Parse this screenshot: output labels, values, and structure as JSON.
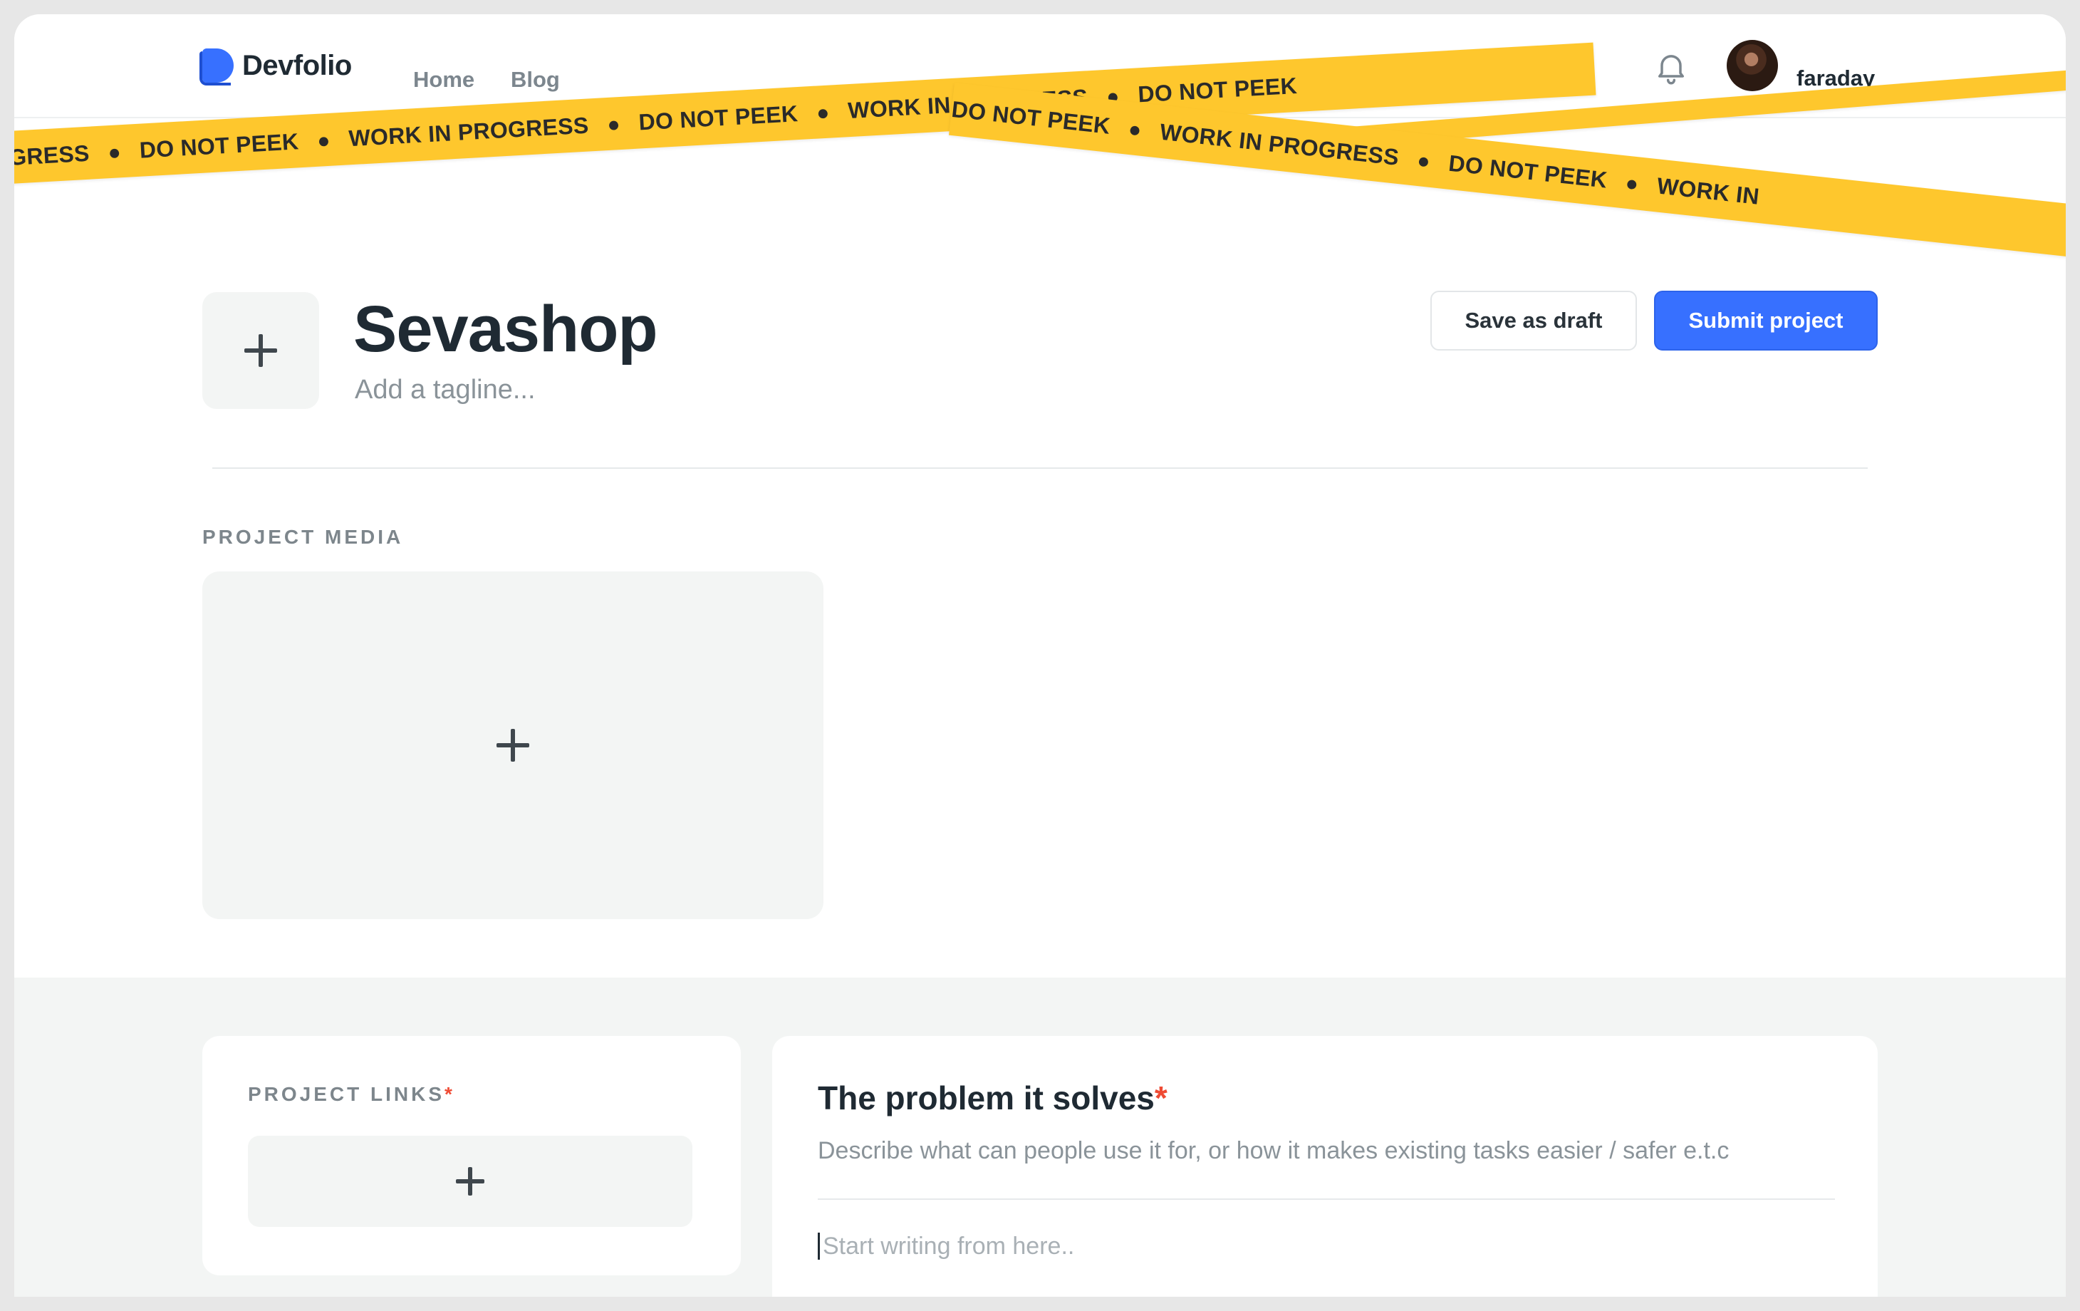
{
  "nav": {
    "logo_text": "Devfolio",
    "links": [
      "Home",
      "Blog"
    ],
    "user": {
      "name": "faraday"
    }
  },
  "tape": {
    "phrases": [
      "PROGRESS",
      "DO NOT PEEK",
      "WORK IN PROGRESS",
      "DO NOT PEEK",
      "WORK IN PROGRESS",
      "DO NOT PEEK",
      "WORK IN PROGRESS",
      "DO NOT PEEK",
      "WORK IN"
    ],
    "color": "#fec72d"
  },
  "project": {
    "title": "Sevashop",
    "tagline_placeholder": "Add a tagline..."
  },
  "actions": {
    "save_draft": "Save as draft",
    "submit": "Submit project"
  },
  "media": {
    "label": "PROJECT MEDIA"
  },
  "links_card": {
    "label": "PROJECT LINKS",
    "required_mark": "*"
  },
  "problem_card": {
    "title": "The problem it solves",
    "required_mark": "*",
    "description": "Describe what can people use it for, or how it makes existing tasks easier / safer e.t.c",
    "editor_placeholder": "Start writing from here.."
  },
  "colors": {
    "accent": "#3770ff",
    "required": "#ef4b34",
    "tape": "#fec72d"
  }
}
